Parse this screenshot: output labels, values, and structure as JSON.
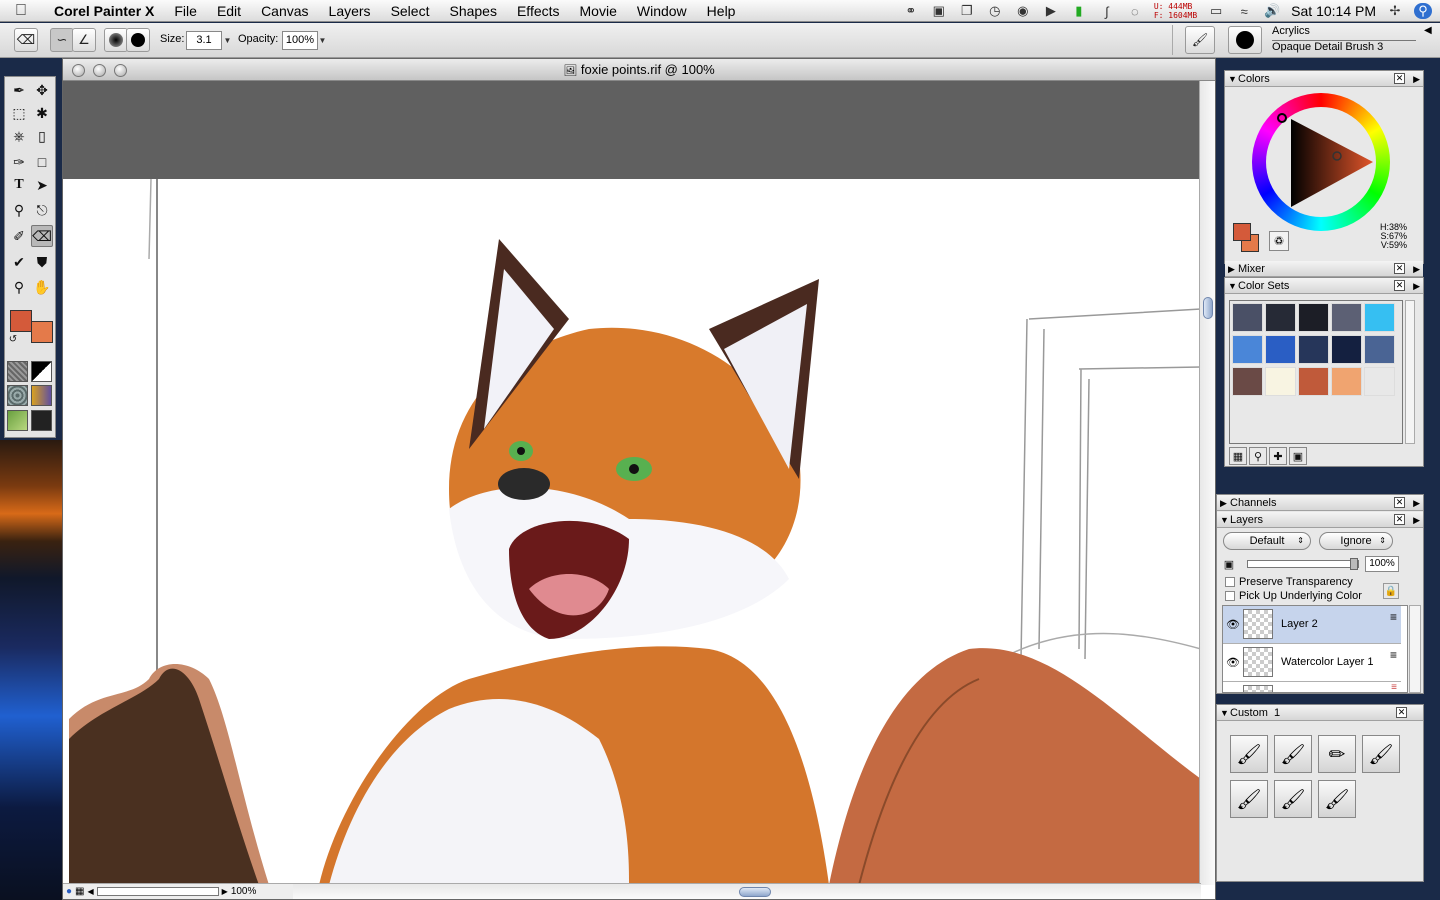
{
  "menubar": {
    "app_name": "Corel Painter X",
    "menus": [
      "File",
      "Edit",
      "Canvas",
      "Layers",
      "Select",
      "Shapes",
      "Effects",
      "Movie",
      "Window",
      "Help"
    ],
    "memory_u": "U: 444MB",
    "memory_f": "F: 1604MB",
    "clock": "Sat 10:14 PM"
  },
  "propbar": {
    "size_label": "Size:",
    "size_value": "3.1",
    "opacity_label": "Opacity:",
    "opacity_value": "100%",
    "brush_category": "Acrylics",
    "brush_variant": "Opaque Detail Brush 3"
  },
  "document": {
    "title": "foxie points.rif @ 100%",
    "zoom": "100%"
  },
  "colors_panel": {
    "title": "Colors",
    "hue": "H:38%",
    "saturation": "S:67%",
    "value": "V:59%",
    "main_color": "#d45a3a",
    "additional_color": "#e47a4a"
  },
  "mixer_panel": {
    "title": "Mixer"
  },
  "color_sets_panel": {
    "title": "Color Sets",
    "swatches": [
      [
        "#4a5066",
        "#262a36",
        "#1c1e26",
        "#5c6074",
        "#36bff2"
      ],
      [
        "#4a86d8",
        "#2a5ec4",
        "#26365a",
        "#142040",
        "#4a6494"
      ],
      [
        "#6a4a46",
        "#f8f4e2",
        "#c05a3a",
        "#f0a470",
        "#e8e8e8"
      ]
    ]
  },
  "channels_panel": {
    "title": "Channels"
  },
  "layers_panel": {
    "title": "Layers",
    "composite_method": "Default",
    "depth": "Ignore",
    "opacity": "100%",
    "preserve_transparency": "Preserve Transparency",
    "pick_up_color": "Pick Up Underlying Color",
    "layers": [
      "Layer 2",
      "Watercolor Layer 1"
    ]
  },
  "custom_panel": {
    "title": "Custom",
    "number": "1"
  }
}
